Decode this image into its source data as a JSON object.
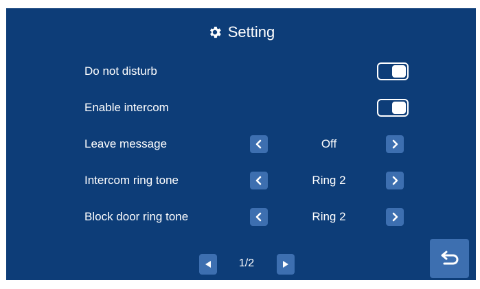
{
  "header": {
    "title": "Setting",
    "icon": "gear-icon"
  },
  "settings": [
    {
      "label": "Do not disturb",
      "control": "toggle",
      "state": "on"
    },
    {
      "label": "Enable intercom",
      "control": "toggle",
      "state": "on"
    },
    {
      "label": "Leave message",
      "control": "selector",
      "value": "Off"
    },
    {
      "label": "Intercom ring tone",
      "control": "selector",
      "value": "Ring 2"
    },
    {
      "label": "Block door ring tone",
      "control": "selector",
      "value": "Ring 2"
    }
  ],
  "pagination": {
    "page": "1/2"
  },
  "colors": {
    "background": "#0d3d78",
    "button": "#3d6fb0",
    "text": "#ffffff"
  },
  "icons": {
    "prev": "chevron-left-icon",
    "next": "chevron-right-icon",
    "back": "return-icon"
  }
}
